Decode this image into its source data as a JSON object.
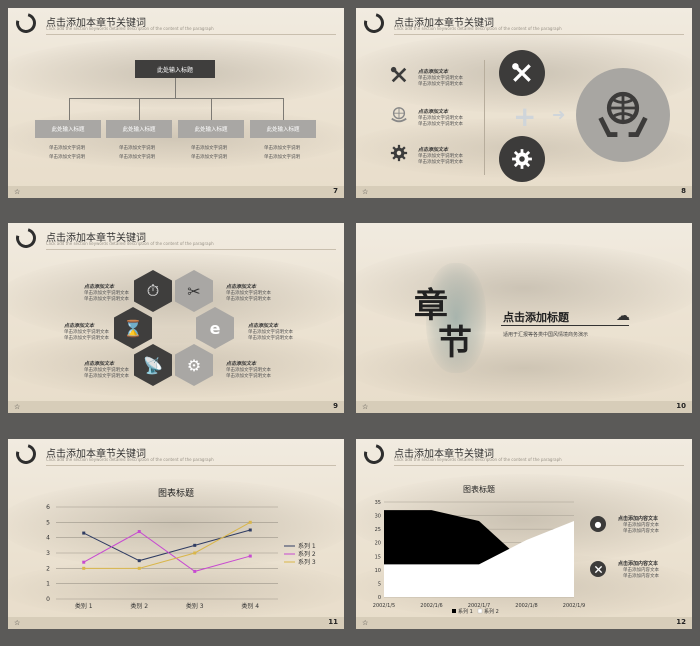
{
  "header_title": "点击添加本章节关键词",
  "header_sub": "Click add the section keywords detailed description of the content of the paragraph",
  "footer_icon": "☆",
  "slide7": {
    "page": "7",
    "top_box": "此处输入标题",
    "boxes": [
      "此处输入标题",
      "此处输入标题",
      "此处输入标题",
      "此处输入标题"
    ],
    "desc_line1": "单击添加文字说明",
    "desc_line2": "单击添加文字说明"
  },
  "slide8": {
    "page": "8",
    "items": [
      {
        "title": "点击添加文本",
        "line1": "单击添加文字说明文本",
        "line2": "单击添加文字说明文本",
        "icon": "tools-icon"
      },
      {
        "title": "点击添加文本",
        "line1": "单击添加文字说明文本",
        "line2": "单击添加文字说明文本",
        "icon": "globe-hands-icon"
      },
      {
        "title": "点击添加文本",
        "line1": "单击添加文字说明文本",
        "line2": "单击添加文字说明文本",
        "icon": "gear-icon"
      }
    ],
    "plus": "+",
    "arrow": "➜"
  },
  "slide9": {
    "page": "9",
    "label_title": "点击添加文本",
    "label_line1": "单击添加文字说明文本",
    "label_line2": "单击添加文字说明文本"
  },
  "slide10": {
    "page": "10",
    "calligraphy1": "章",
    "calligraphy2": "节",
    "title": "点击添加标题",
    "sub": "适用于汇报等各类中国风情境商务演示",
    "cloud": "☁"
  },
  "slide11": {
    "page": "11",
    "chart_title": "图表标题",
    "legend": [
      "系列 1",
      "系列 2",
      "系列 3"
    ]
  },
  "slide12": {
    "page": "12",
    "chart_title": "图表标题",
    "legend": [
      "系列 1",
      "系列 2"
    ],
    "items": [
      {
        "title": "点击添加内容文本",
        "line1": "单击添加内容文本",
        "line2": "单击添加内容文本"
      },
      {
        "title": "点击添加内容文本",
        "line1": "单击添加内容文本",
        "line2": "单击添加内容文本"
      }
    ]
  },
  "chart_data": [
    {
      "type": "line",
      "title": "图表标题",
      "categories": [
        "类别 1",
        "类别 2",
        "类别 3",
        "类别 4"
      ],
      "ylim": [
        0,
        6
      ],
      "yticks": [
        0,
        1,
        2,
        3,
        4,
        5,
        6
      ],
      "ylabel": "",
      "series": [
        {
          "name": "系列 1",
          "values": [
            4.3,
            2.5,
            3.5,
            4.5
          ],
          "color": "#2f3c63"
        },
        {
          "name": "系列 2",
          "values": [
            2.4,
            4.4,
            1.8,
            2.8
          ],
          "color": "#c74ad1"
        },
        {
          "name": "系列 3",
          "values": [
            2.0,
            2.0,
            3.0,
            5.0
          ],
          "color": "#d9b64a"
        }
      ],
      "legend": "right"
    },
    {
      "type": "area",
      "title": "图表标题",
      "x": [
        "2002/1/5",
        "2002/1/6",
        "2002/1/7",
        "2002/1/8",
        "2002/1/9"
      ],
      "ylim": [
        0,
        35
      ],
      "yticks": [
        0,
        5,
        10,
        15,
        20,
        25,
        30,
        35
      ],
      "series": [
        {
          "name": "系列 1",
          "values": [
            32,
            32,
            28,
            12,
            15
          ],
          "color": "#000000"
        },
        {
          "name": "系列 2",
          "values": [
            12,
            12,
            12,
            21,
            28
          ],
          "color": "#ffffff"
        }
      ],
      "legend": "bottom"
    }
  ]
}
